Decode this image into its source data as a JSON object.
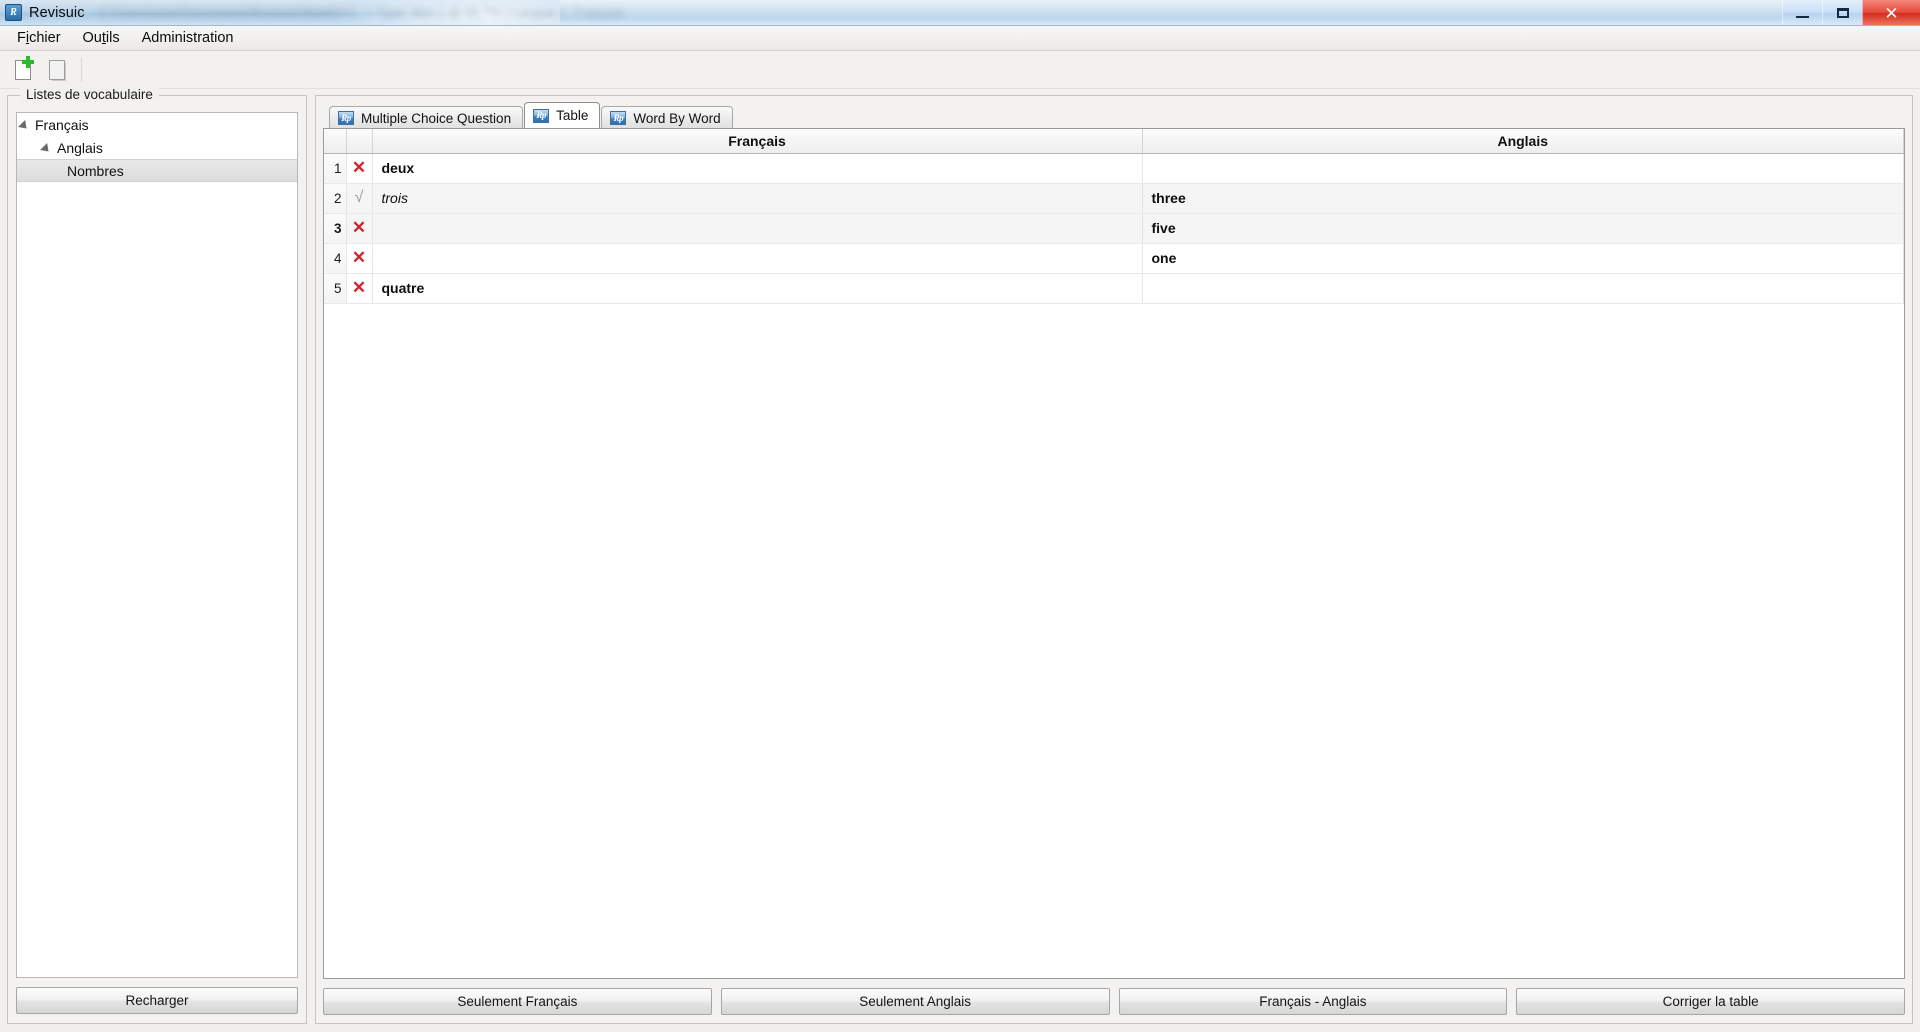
{
  "window": {
    "title": "Revisuic",
    "title_blur": "C:\\Users\\user\\Documents\\Revisuic\\Nombres — Type: Mot 1 @ 66,7% | Langue 1: Français",
    "app_icon_letter": "R",
    "minimize_label": "Minimize",
    "maximize_label": "Maximize",
    "close_label": "✕"
  },
  "menubar": {
    "items": [
      {
        "pre": "F",
        "mnemonic": "i",
        "post": "chier"
      },
      {
        "pre": "Ou",
        "mnemonic": "t",
        "post": "ils"
      },
      {
        "pre": "Administration",
        "mnemonic": "",
        "post": ""
      }
    ]
  },
  "toolbar": {
    "new_list_label": "new-document-icon",
    "open_list_label": "document-icon"
  },
  "sidebar": {
    "panel_title": "Listes de vocabulaire",
    "tree": [
      {
        "label": "Français",
        "level": 0,
        "expanded": true,
        "selected": false
      },
      {
        "label": "Anglais",
        "level": 1,
        "expanded": true,
        "selected": false
      },
      {
        "label": "Nombres",
        "level": 2,
        "expanded": false,
        "selected": true
      }
    ],
    "reload_button": "Recharger"
  },
  "tabs": [
    {
      "label": "Multiple Choice Question",
      "icon": "revisuic-icon",
      "icon_text": "Rp",
      "active": false
    },
    {
      "label": "Table",
      "icon": "revisuic-icon",
      "icon_text": "Rp",
      "active": true
    },
    {
      "label": "Word By Word",
      "icon": "revisuic-icon",
      "icon_text": "Rp",
      "active": false
    }
  ],
  "table": {
    "columns": [
      "",
      "",
      "Français",
      "Anglais"
    ],
    "headers": {
      "french": "Français",
      "english": "Anglais"
    },
    "rows": [
      {
        "num": "1",
        "num_bold": false,
        "mark": "x",
        "french": "deux",
        "french_style": "bold",
        "english": "",
        "english_style": "bold",
        "alt": false
      },
      {
        "num": "2",
        "num_bold": false,
        "mark": "v",
        "french": "trois",
        "french_style": "italic",
        "english": "three",
        "english_style": "bold",
        "alt": true
      },
      {
        "num": "3",
        "num_bold": true,
        "mark": "x",
        "french": "",
        "french_style": "bold",
        "english": "five",
        "english_style": "bold",
        "alt": true
      },
      {
        "num": "4",
        "num_bold": false,
        "mark": "x",
        "french": "",
        "french_style": "bold",
        "english": "one",
        "english_style": "bold",
        "alt": false
      },
      {
        "num": "5",
        "num_bold": false,
        "mark": "x",
        "french": "quatre",
        "french_style": "bold",
        "english": "",
        "english_style": "bold",
        "alt": false
      }
    ],
    "mark_glyphs": {
      "x": "✕",
      "v": "√"
    },
    "mark_colors": {
      "x": "#d0242a",
      "v": "#9a9a9a"
    }
  },
  "actions": [
    {
      "label": "Seulement Français"
    },
    {
      "label": "Seulement Anglais"
    },
    {
      "label": "Français - Anglais"
    },
    {
      "label": "Corriger la table"
    }
  ]
}
